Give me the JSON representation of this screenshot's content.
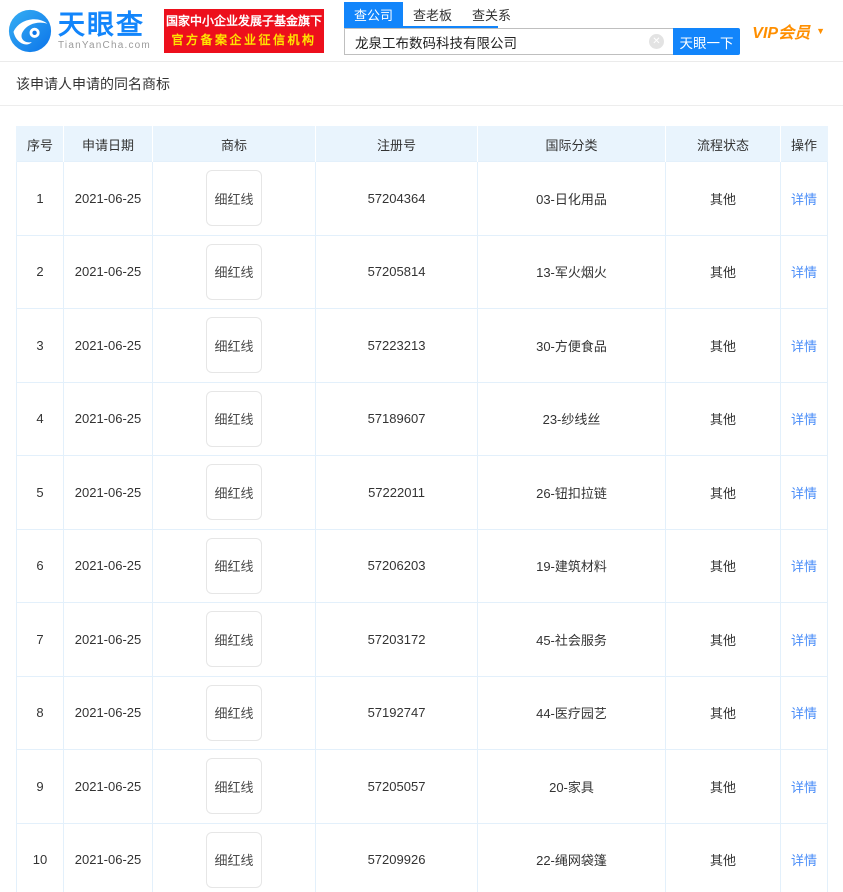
{
  "header": {
    "logo": {
      "title": "天眼查",
      "subtitle": "TianYanCha.com"
    },
    "badge": {
      "line1": "国家中小企业发展子基金旗下",
      "line2": "官方备案企业征信机构"
    },
    "search": {
      "tabs": [
        {
          "label": "查公司"
        },
        {
          "label": "查老板"
        },
        {
          "label": "查关系"
        }
      ],
      "input_value": "龙泉工布数码科技有限公司",
      "clear_icon": "✕",
      "button_label": "天眼一下"
    },
    "vip_label": "VIP会员",
    "vip_caret": "▼"
  },
  "section": {
    "title": "该申请人申请的同名商标"
  },
  "table": {
    "columns": [
      "序号",
      "申请日期",
      "商标",
      "注册号",
      "国际分类",
      "流程状态",
      "操作"
    ],
    "rows": [
      {
        "no": "1",
        "date": "2021-06-25",
        "trademark": "细红线",
        "reg_no": "57204364",
        "intl_class": "03-日化用品",
        "status": "其他",
        "action": "详情"
      },
      {
        "no": "2",
        "date": "2021-06-25",
        "trademark": "细红线",
        "reg_no": "57205814",
        "intl_class": "13-军火烟火",
        "status": "其他",
        "action": "详情"
      },
      {
        "no": "3",
        "date": "2021-06-25",
        "trademark": "细红线",
        "reg_no": "57223213",
        "intl_class": "30-方便食品",
        "status": "其他",
        "action": "详情"
      },
      {
        "no": "4",
        "date": "2021-06-25",
        "trademark": "细红线",
        "reg_no": "57189607",
        "intl_class": "23-纱线丝",
        "status": "其他",
        "action": "详情"
      },
      {
        "no": "5",
        "date": "2021-06-25",
        "trademark": "细红线",
        "reg_no": "57222011",
        "intl_class": "26-钮扣拉链",
        "status": "其他",
        "action": "详情"
      },
      {
        "no": "6",
        "date": "2021-06-25",
        "trademark": "细红线",
        "reg_no": "57206203",
        "intl_class": "19-建筑材料",
        "status": "其他",
        "action": "详情"
      },
      {
        "no": "7",
        "date": "2021-06-25",
        "trademark": "细红线",
        "reg_no": "57203172",
        "intl_class": "45-社会服务",
        "status": "其他",
        "action": "详情"
      },
      {
        "no": "8",
        "date": "2021-06-25",
        "trademark": "细红线",
        "reg_no": "57192747",
        "intl_class": "44-医疗园艺",
        "status": "其他",
        "action": "详情"
      },
      {
        "no": "9",
        "date": "2021-06-25",
        "trademark": "细红线",
        "reg_no": "57205057",
        "intl_class": "20-家具",
        "status": "其他",
        "action": "详情"
      },
      {
        "no": "10",
        "date": "2021-06-25",
        "trademark": "细红线",
        "reg_no": "57209926",
        "intl_class": "22-绳网袋篷",
        "status": "其他",
        "action": "详情"
      }
    ]
  },
  "interface_colors": {
    "brand_blue": "#1285fb",
    "badge_red": "#ed0f1c",
    "badge_gold": "#ffe400",
    "vip_orange": "#ff8f00",
    "link_blue": "#4a8df8",
    "table_header_bg": "#e9f4fd",
    "table_border": "#e3f0fb"
  }
}
